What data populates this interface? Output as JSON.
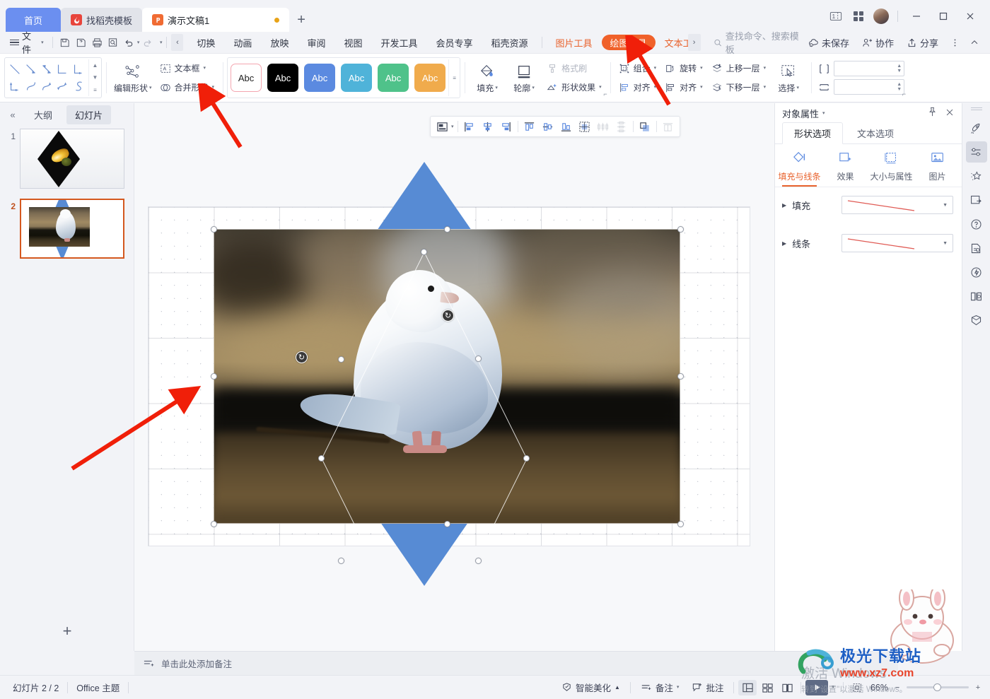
{
  "app": {
    "window_tabs": [
      {
        "label": "首页",
        "type": "home",
        "icon": "home-tab"
      },
      {
        "label": "找稻壳模板",
        "type": "normal",
        "icon": "docer-icon"
      },
      {
        "label": "演示文稿1",
        "type": "active",
        "icon": "ppt-file-icon",
        "modified": true
      }
    ],
    "new_tab_label": "+",
    "title_right": {
      "layout_icon": "window-split-icon",
      "apps_icon": "app-grid-icon",
      "avatar": "user-avatar",
      "minimize": "minimize-icon",
      "maximize": "maximize-icon",
      "close": "close-icon"
    }
  },
  "menubar": {
    "file_label": "文件",
    "quick_access": [
      "save-icon",
      "save-as-icon",
      "print-icon",
      "print-preview-icon",
      "undo-icon",
      "redo-icon",
      "customize-icon"
    ],
    "collapse_label": "‹",
    "tabs": [
      {
        "label": "切换",
        "state": "normal"
      },
      {
        "label": "动画",
        "state": "normal"
      },
      {
        "label": "放映",
        "state": "normal"
      },
      {
        "label": "审阅",
        "state": "normal"
      },
      {
        "label": "视图",
        "state": "normal"
      },
      {
        "label": "开发工具",
        "state": "normal"
      },
      {
        "label": "会员专享",
        "state": "normal"
      },
      {
        "label": "稻壳资源",
        "state": "normal"
      },
      {
        "label": "图片工具",
        "state": "context"
      },
      {
        "label": "绘图工具",
        "state": "context-active"
      },
      {
        "label": "文本工",
        "state": "context-truncated"
      }
    ],
    "more_tabs_label": "›",
    "search_placeholder": "查找命令、搜索模板",
    "right_items": [
      {
        "label": "未保存",
        "icon": "cloud-unsaved-icon"
      },
      {
        "label": "协作",
        "icon": "collab-icon"
      },
      {
        "label": "分享",
        "icon": "share-icon"
      }
    ],
    "more_icon": "more-vertical-icon",
    "collapse_ribbon_icon": "chevron-up-icon"
  },
  "ribbon": {
    "shape_gallery": {
      "name": "shape-gallery",
      "rows": [
        [
          "line",
          "line-arrow",
          "line-double-arrow",
          "elbow-connector",
          "elbow-arrow-connector"
        ],
        [
          "elbow-double-arrow",
          "curve-connector",
          "curve-arrow",
          "curve-double-arrow",
          "freeform-s"
        ]
      ]
    },
    "edit_shape": {
      "label": "编辑形状",
      "icon": "edit-points-icon"
    },
    "text_box": {
      "label": "文本框",
      "icon": "text-box-icon"
    },
    "merge_shapes": {
      "label": "合并形状",
      "icon": "merge-shapes-icon"
    },
    "style_gallery": [
      {
        "label": "Abc",
        "bg": "#ffffff",
        "fg": "#222222",
        "border": "#f4a6b0"
      },
      {
        "label": "Abc",
        "bg": "#000000",
        "fg": "#ffffff",
        "border": "#000000"
      },
      {
        "label": "Abc",
        "bg": "#5b8ae0",
        "fg": "#ffffff",
        "border": "#5b8ae0"
      },
      {
        "label": "Abc",
        "bg": "#4fb3d9",
        "fg": "#ffffff",
        "border": "#4fb3d9"
      },
      {
        "label": "Abc",
        "bg": "#4fc28a",
        "fg": "#ffffff",
        "border": "#4fc28a"
      },
      {
        "label": "Abc",
        "bg": "#f0ab4c",
        "fg": "#ffffff",
        "border": "#f0ab4c"
      }
    ],
    "fill": {
      "label": "填充",
      "icon": "fill-bucket-icon"
    },
    "outline": {
      "label": "轮廓",
      "icon": "shape-outline-icon"
    },
    "format_painter": {
      "label": "格式刷",
      "icon": "format-painter-icon",
      "disabled": true
    },
    "shape_effects": {
      "label": "形状效果",
      "icon": "shape-effects-icon"
    },
    "group": {
      "label": "组合",
      "icon": "group-icon"
    },
    "align": {
      "label": "对齐",
      "icon": "align-icon"
    },
    "rotate": {
      "label": "旋转",
      "icon": "rotate-icon"
    },
    "bring_forward": {
      "label": "上移一层",
      "icon": "bring-forward-icon"
    },
    "send_backward": {
      "label": "下移一层",
      "icon": "send-backward-icon"
    },
    "select": {
      "label": "选择",
      "icon": "select-objects-icon"
    },
    "size": {
      "height_icon": "shape-height-icon",
      "width_icon": "shape-width-icon",
      "height_value": "",
      "width_value": ""
    }
  },
  "left_panel": {
    "collapse_icon": "collapse-left-icon",
    "tabs": [
      {
        "label": "大纲",
        "active": false
      },
      {
        "label": "幻灯片",
        "active": true
      }
    ],
    "slides": [
      {
        "number": "1",
        "selected": false,
        "name": "slide-thumb-1"
      },
      {
        "number": "2",
        "selected": true,
        "name": "slide-thumb-2"
      }
    ],
    "add_slide_label": "+"
  },
  "float_toolbar": {
    "buttons": [
      {
        "icon": "selection-pane-icon",
        "has_caret": true,
        "disabled": false
      },
      {
        "icon": "align-left-icon",
        "disabled": false
      },
      {
        "icon": "align-center-h-icon",
        "disabled": false
      },
      {
        "icon": "align-right-icon",
        "disabled": false
      },
      {
        "icon": "align-top-icon",
        "disabled": false
      },
      {
        "icon": "align-middle-v-icon",
        "disabled": false
      },
      {
        "icon": "align-bottom-icon",
        "disabled": false
      },
      {
        "icon": "align-to-slide-icon",
        "disabled": false
      },
      {
        "icon": "distribute-horizontal-icon",
        "disabled": true
      },
      {
        "icon": "distribute-vertical-icon",
        "disabled": true
      },
      {
        "icon": "group-objects-icon",
        "disabled": false
      },
      {
        "icon": "send-to-back-icon",
        "disabled": true
      }
    ]
  },
  "canvas": {
    "slide_name": "slide-canvas",
    "shapes": [
      {
        "name": "blue-diamond-shape",
        "fill": "#578bd4",
        "selected": true
      },
      {
        "name": "dove-picture",
        "selected": true
      }
    ],
    "scrollbar": {
      "name": "canvas-vertical-scrollbar"
    }
  },
  "notes": {
    "icon": "notes-icon",
    "placeholder": "单击此处添加备注"
  },
  "right_panel": {
    "title": "对象属性",
    "pin_icon": "pin-icon",
    "close_icon": "close-icon",
    "tabs": [
      {
        "label": "形状选项",
        "active": true
      },
      {
        "label": "文本选项",
        "active": false
      }
    ],
    "subtabs": [
      {
        "label": "填充与线条",
        "icon": "fill-line-icon",
        "active": true
      },
      {
        "label": "效果",
        "icon": "effects-icon",
        "active": false
      },
      {
        "label": "大小与属性",
        "icon": "size-properties-icon",
        "active": false
      },
      {
        "label": "图片",
        "icon": "picture-icon",
        "active": false
      }
    ],
    "sections": [
      {
        "label": "填充",
        "expander": "▶",
        "preview": "red-diagonal-line",
        "name": "fill-section"
      },
      {
        "label": "线条",
        "expander": "▶",
        "preview": "red-diagonal-line",
        "name": "line-section"
      }
    ]
  },
  "rail": {
    "items": [
      {
        "icon": "rocket-icon",
        "active": false,
        "name": "rail-feature-tour"
      },
      {
        "icon": "sliders-icon",
        "active": true,
        "name": "rail-object-properties"
      },
      {
        "icon": "magic-star-icon",
        "active": false,
        "name": "rail-smart-beautify"
      },
      {
        "icon": "insert-frame-icon",
        "active": false,
        "name": "rail-insert-resource"
      },
      {
        "icon": "help-circle-icon",
        "active": false,
        "name": "rail-help"
      },
      {
        "icon": "document-scan-icon",
        "active": false,
        "name": "rail-doc-check"
      },
      {
        "icon": "shield-bolt-icon",
        "active": false,
        "name": "rail-quick-action"
      },
      {
        "icon": "book-search-icon",
        "active": false,
        "name": "rail-reference"
      },
      {
        "icon": "box-icon",
        "active": false,
        "name": "rail-resource-box"
      }
    ]
  },
  "statusbar": {
    "slide_counter": "幻灯片 2 / 2",
    "theme": "Office 主题",
    "smart_beautify": {
      "label": "智能美化",
      "icon": "beautify-icon",
      "caret": "▲"
    },
    "notes_button": {
      "label": "备注",
      "icon": "notes-small-icon"
    },
    "comment_button": {
      "label": "批注",
      "icon": "comment-icon"
    },
    "views": [
      {
        "icon": "normal-view-icon",
        "active": true,
        "name": "view-normal"
      },
      {
        "icon": "slide-sorter-icon",
        "active": false,
        "name": "view-sorter"
      },
      {
        "icon": "reading-view-icon",
        "active": false,
        "name": "view-reading"
      }
    ],
    "play_button": {
      "icon": "play-icon",
      "caret": "▾"
    },
    "fit_icon": "fit-to-window-icon",
    "zoom_level": "66%",
    "zoom_out": "−",
    "zoom_in": "+"
  },
  "watermarks": {
    "windows_activation_line1": "激活 Windows",
    "windows_activation_line2": "转到\"设置\"以激活 Windows。",
    "site_name": "极光下载站",
    "site_url": "www.xz7.com"
  },
  "annotations": [
    {
      "name": "red-arrow-to-merge-shapes"
    },
    {
      "name": "red-arrow-to-drawing-tools-tab"
    },
    {
      "name": "red-arrow-to-slide-canvas"
    }
  ]
}
